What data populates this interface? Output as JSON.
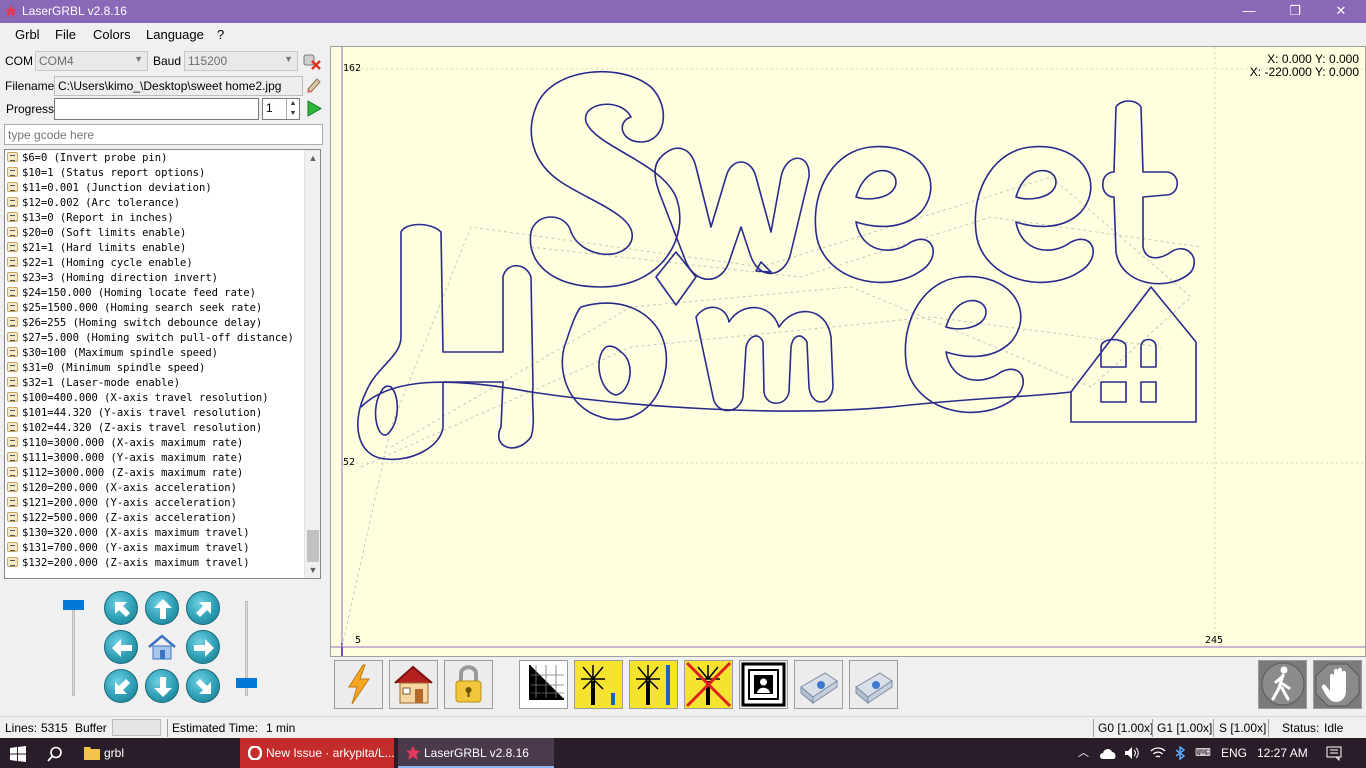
{
  "window": {
    "title": "LaserGRBL v2.8.16",
    "minimize": "—",
    "restore": "❐",
    "close": "✕"
  },
  "menu": [
    "Grbl",
    "File",
    "Colors",
    "Language",
    "?"
  ],
  "connection": {
    "com_label": "COM",
    "com_value": "COM4",
    "baud_label": "Baud",
    "baud_value": "115200"
  },
  "file": {
    "filename_label": "Filename",
    "filename_value": "C:\\Users\\kimo_\\Desktop\\sweet home2.jpg"
  },
  "progress": {
    "label": "Progress",
    "copies": "1"
  },
  "gcode_input": {
    "placeholder": "type gcode here"
  },
  "console_lines": [
    "$6=0 (Invert probe pin)",
    "$10=1 (Status report options)",
    "$11=0.001 (Junction deviation)",
    "$12=0.002 (Arc tolerance)",
    "$13=0 (Report in inches)",
    "$20=0 (Soft limits enable)",
    "$21=1 (Hard limits enable)",
    "$22=1 (Homing cycle enable)",
    "$23=3 (Homing direction invert)",
    "$24=150.000 (Homing locate feed rate)",
    "$25=1500.000 (Homing search seek rate)",
    "$26=255 (Homing switch debounce delay)",
    "$27=5.000 (Homing switch pull-off distance)",
    "$30=100 (Maximum spindle speed)",
    "$31=0 (Minimum spindle speed)",
    "$32=1 (Laser-mode enable)",
    "$100=400.000 (X-axis travel resolution)",
    "$101=44.320 (Y-axis travel resolution)",
    "$102=44.320 (Z-axis travel resolution)",
    "$110=3000.000 (X-axis maximum rate)",
    "$111=3000.000 (Y-axis maximum rate)",
    "$112=3000.000 (Z-axis maximum rate)",
    "$120=200.000 (X-axis acceleration)",
    "$121=200.000 (Y-axis acceleration)",
    "$122=500.000 (Z-axis acceleration)",
    "$130=320.000 (X-axis maximum travel)",
    "$131=700.000 (Y-axis maximum travel)",
    "$132=200.000 (Z-axis maximum travel)"
  ],
  "canvas": {
    "coords_line1": "X: 0.000 Y: 0.000",
    "coords_line2": "X: -220.000 Y: 0.000",
    "y_top_label": "162",
    "y_mid_label": "52",
    "x_left_label": "5",
    "x_right_label": "245"
  },
  "status": {
    "lines_label": "Lines:",
    "lines_value": "5315",
    "buffer_label": "Buffer",
    "est_label": "Estimated Time:",
    "est_value": "1 min",
    "g0": "G0 [1.00x]",
    "g1": "G1 [1.00x]",
    "s": "S [1.00x]",
    "state_label": "Status:",
    "state_value": "Idle"
  },
  "taskbar": {
    "item1": "grbl",
    "item2": "New Issue · arkypita/L...",
    "item3": "LaserGRBL v2.8.16",
    "lang": "ENG",
    "time": "12:27 AM"
  },
  "colors": {
    "titlebar": "#8a68b8",
    "canvas_bg": "#ffffe0",
    "path": "#2a2a8c",
    "accent": "#0078d7"
  }
}
